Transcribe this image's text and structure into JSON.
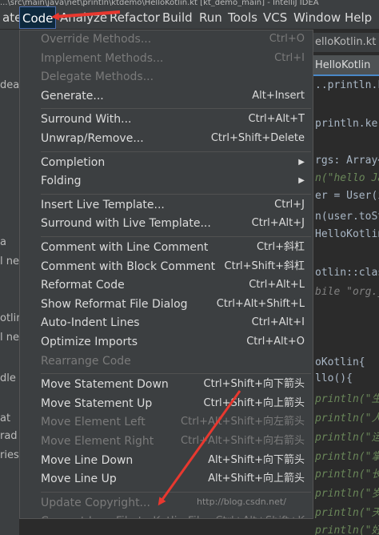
{
  "title_text": "...\\src\\main\\java\\net\\println\\ktdemo\\HelloKotlin.kt [kt_demo_main] - IntelliJ IDEA",
  "menubar": [
    {
      "label": "ate",
      "active": false
    },
    {
      "label": "Code",
      "active": true
    },
    {
      "label": "Analyze",
      "active": false
    },
    {
      "label": "Refactor",
      "active": false
    },
    {
      "label": "Build",
      "active": false
    },
    {
      "label": "Run",
      "active": false
    },
    {
      "label": "Tools",
      "active": false
    },
    {
      "label": "VCS",
      "active": false
    },
    {
      "label": "Window",
      "active": false
    },
    {
      "label": "Help",
      "active": false
    }
  ],
  "left_labels": [
    "dea",
    "a",
    "l ne",
    "otlin",
    "l ne",
    "dle",
    "at",
    "rad",
    "ries"
  ],
  "editor": {
    "tab_top": "elloKotlin.kt",
    "tab_active": "HelloKotlin",
    "lines": [
      {
        "text": "..println.k",
        "kind": "code"
      },
      {
        "text": "println.ke",
        "kind": "code"
      },
      {
        "text": "rgs: Array<",
        "kind": "code"
      },
      {
        "text": "n(\"hello Jav",
        "kind": "str"
      },
      {
        "text": "er = User(i",
        "kind": "code"
      },
      {
        "text": "n(user.toSt",
        "kind": "code"
      },
      {
        "text": "HelloKotlin",
        "kind": "code"
      },
      {
        "text": "otlin::clas",
        "kind": "code"
      },
      {
        "text": "bile \"org.j",
        "kind": "comment"
      },
      {
        "text": "oKotlin{",
        "kind": "code"
      },
      {
        "text": "llo(){",
        "kind": "code"
      },
      {
        "text": "println(\"生命",
        "kind": "str"
      },
      {
        "text": "println(\"人们",
        "kind": "str"
      },
      {
        "text": "println(\"运数",
        "kind": "str"
      },
      {
        "text": "println(\"掌上",
        "kind": "str"
      },
      {
        "text": "println(\"长剑",
        "kind": "str"
      },
      {
        "text": "println(\"岁月",
        "kind": "str"
      },
      {
        "text": "println(\"天际",
        "kind": "str"
      },
      {
        "text": "println(\"好人",
        "kind": "str"
      }
    ]
  },
  "menu": {
    "items": [
      {
        "label": "Override Methods...",
        "shortcut": "Ctrl+O",
        "disabled": true
      },
      {
        "label": "Implement Methods...",
        "shortcut": "Ctrl+I",
        "disabled": true
      },
      {
        "label": "Delegate Methods...",
        "shortcut": "",
        "disabled": true
      },
      {
        "label": "Generate...",
        "shortcut": "Alt+Insert",
        "disabled": false
      },
      {
        "separator": true
      },
      {
        "label": "Surround With...",
        "shortcut": "Ctrl+Alt+T",
        "disabled": false
      },
      {
        "label": "Unwrap/Remove...",
        "shortcut": "Ctrl+Shift+Delete",
        "disabled": false
      },
      {
        "separator": true
      },
      {
        "label": "Completion",
        "shortcut": "",
        "disabled": false,
        "submenu": true
      },
      {
        "label": "Folding",
        "shortcut": "",
        "disabled": false,
        "submenu": true
      },
      {
        "separator": true
      },
      {
        "label": "Insert Live Template...",
        "shortcut": "Ctrl+J",
        "disabled": false
      },
      {
        "label": "Surround with Live Template...",
        "shortcut": "Ctrl+Alt+J",
        "disabled": false
      },
      {
        "separator": true
      },
      {
        "label": "Comment with Line Comment",
        "shortcut": "Ctrl+斜杠",
        "disabled": false
      },
      {
        "label": "Comment with Block Comment",
        "shortcut": "Ctrl+Shift+斜杠",
        "disabled": false
      },
      {
        "label": "Reformat Code",
        "shortcut": "Ctrl+Alt+L",
        "disabled": false
      },
      {
        "label": "Show Reformat File Dialog",
        "shortcut": "Ctrl+Alt+Shift+L",
        "disabled": false
      },
      {
        "label": "Auto-Indent Lines",
        "shortcut": "Ctrl+Alt+I",
        "disabled": false
      },
      {
        "label": "Optimize Imports",
        "shortcut": "Ctrl+Alt+O",
        "disabled": false
      },
      {
        "label": "Rearrange Code",
        "shortcut": "",
        "disabled": true
      },
      {
        "separator": true
      },
      {
        "label": "Move Statement Down",
        "shortcut": "Ctrl+Shift+向下箭头",
        "disabled": false
      },
      {
        "label": "Move Statement Up",
        "shortcut": "Ctrl+Shift+向上箭头",
        "disabled": false
      },
      {
        "label": "Move Element Left",
        "shortcut": "Ctrl+Alt+Shift+向左箭头",
        "disabled": true
      },
      {
        "label": "Move Element Right",
        "shortcut": "Ctrl+Alt+Shift+向右箭头",
        "disabled": true
      },
      {
        "label": "Move Line Down",
        "shortcut": "Alt+Shift+向下箭头",
        "disabled": false
      },
      {
        "label": "Move Line Up",
        "shortcut": "Alt+Shift+向上箭头",
        "disabled": false
      },
      {
        "separator": true
      },
      {
        "label": "Update Copyright...",
        "shortcut": "",
        "disabled": true
      },
      {
        "label": "Convert Java File to Kotlin File",
        "shortcut": "Ctrl+Alt+Shift+K",
        "disabled": true
      }
    ]
  },
  "watermark": "http://blog.csdn.net/",
  "colors": {
    "annotation_arrow": "#e8382f",
    "menu_bg": "#3c3f41",
    "selection": "#4b6eaf"
  }
}
